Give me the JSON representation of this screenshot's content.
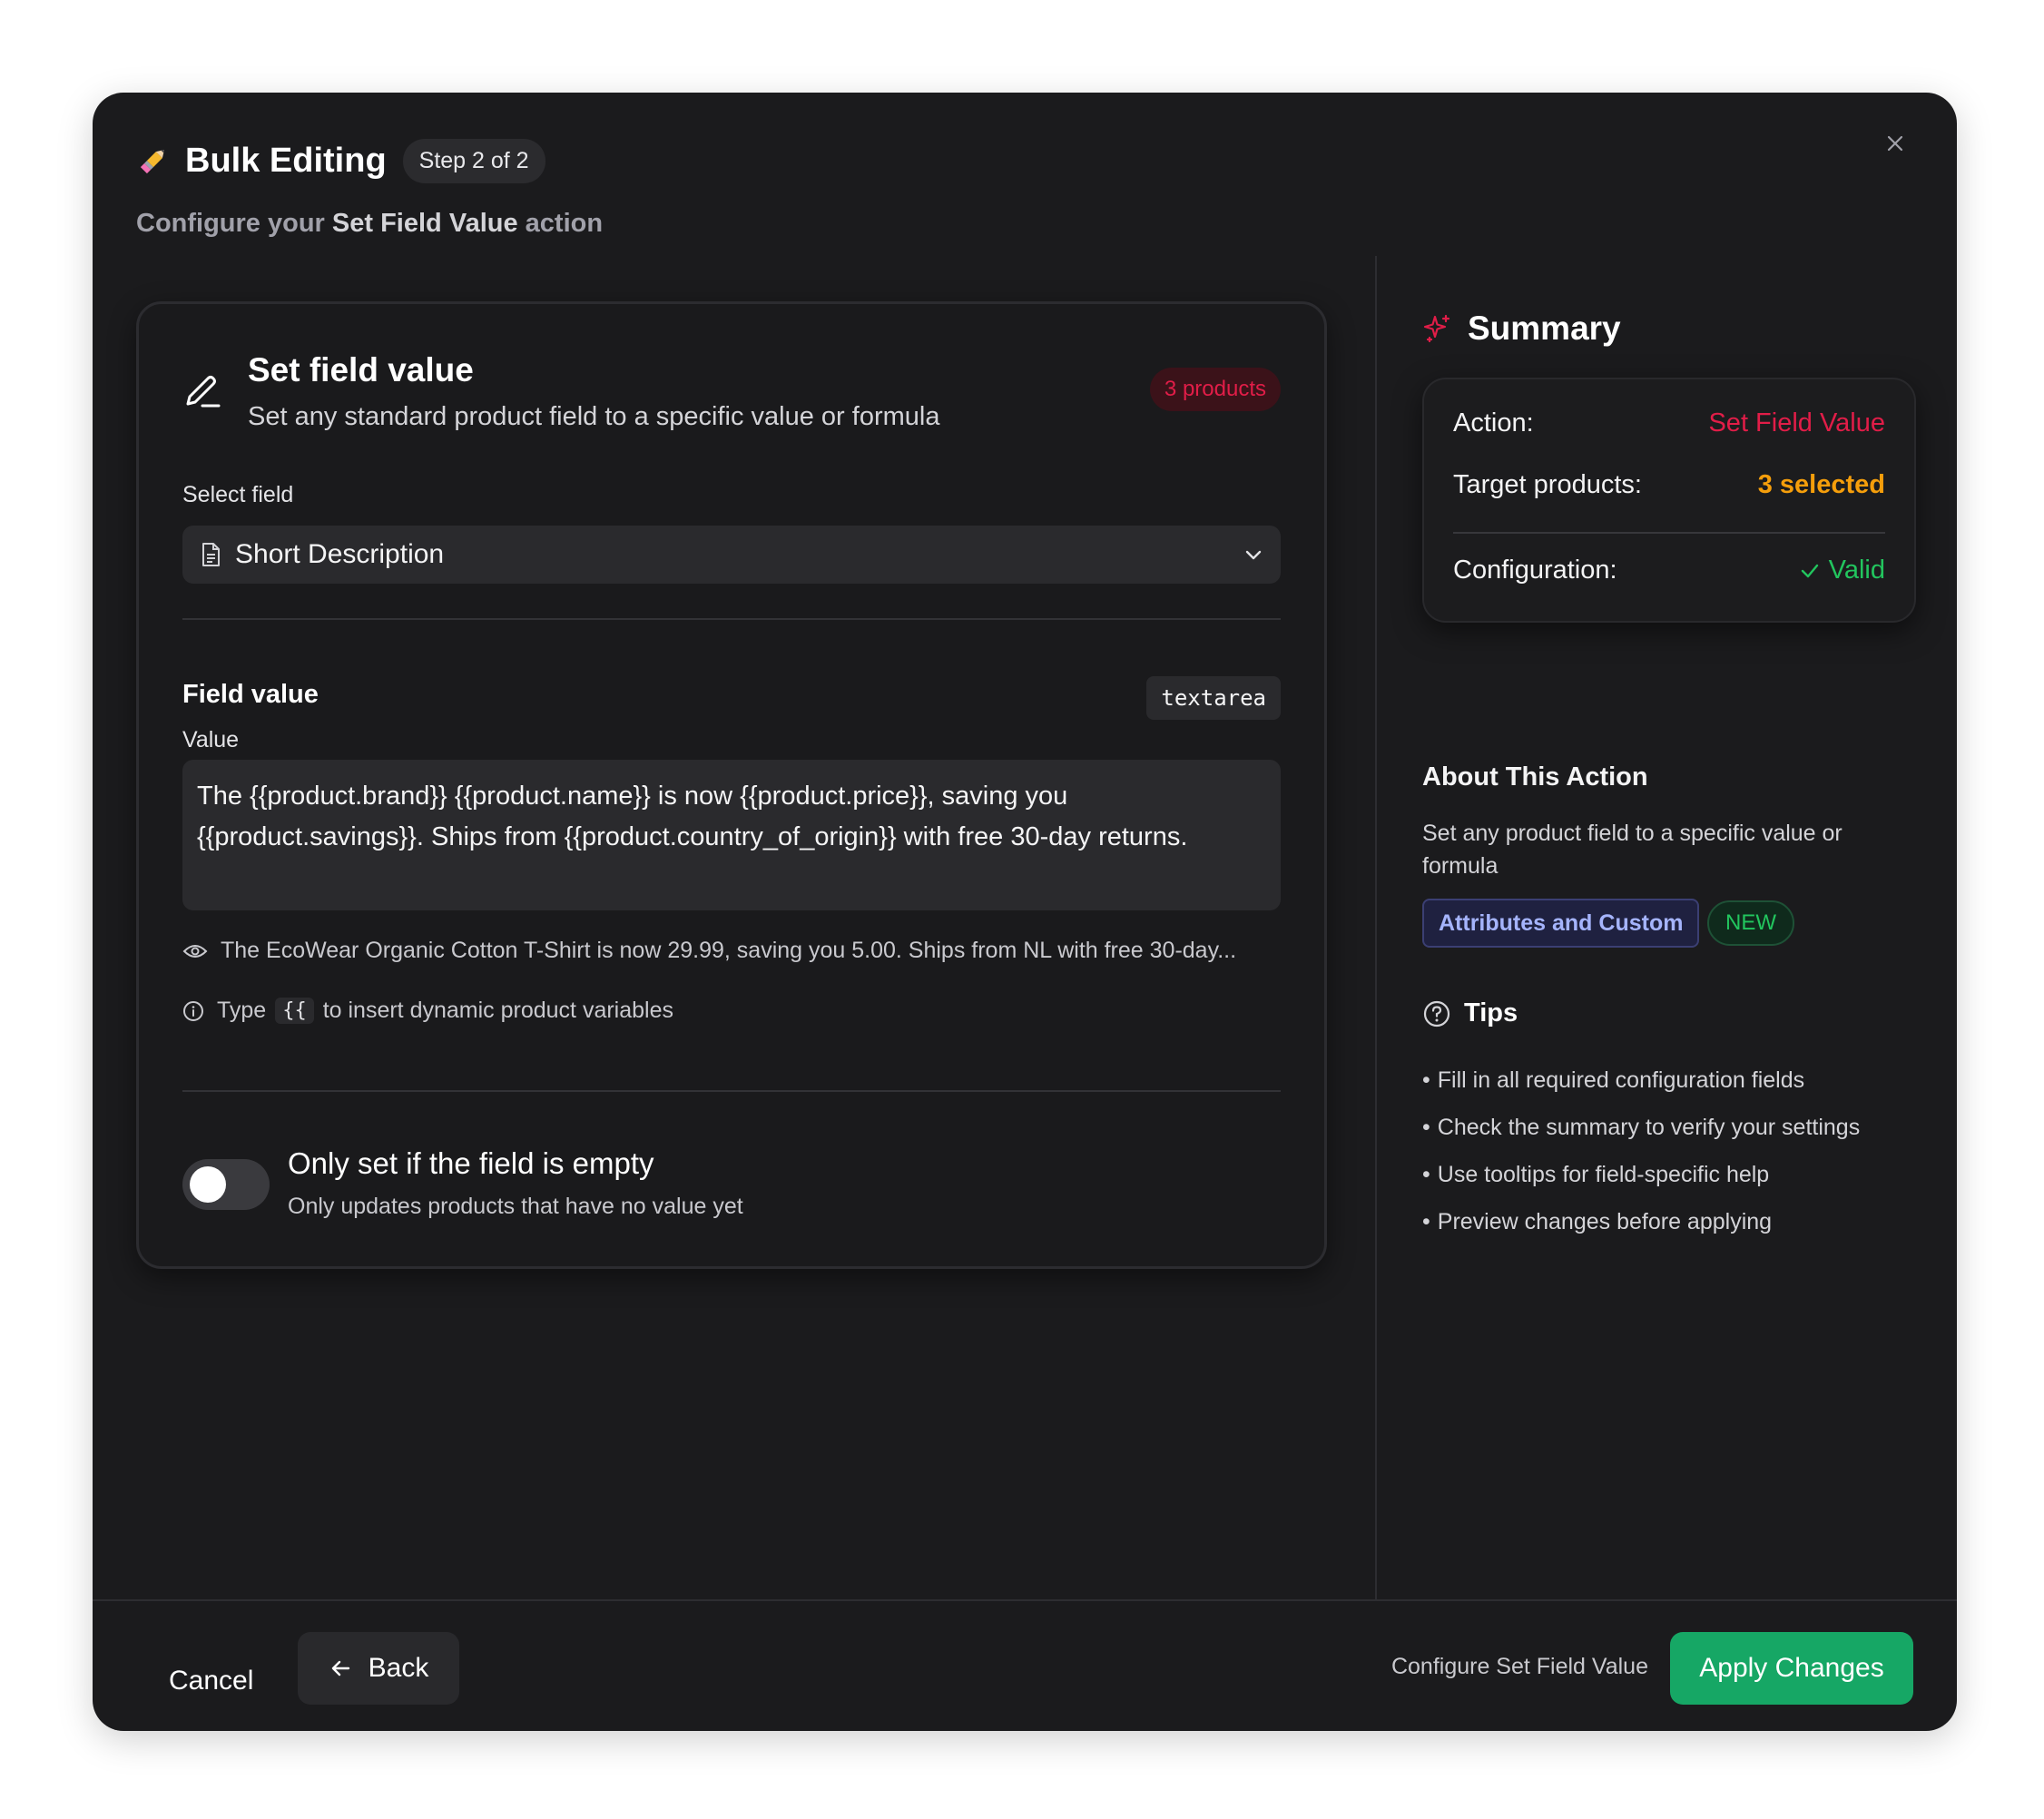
{
  "header": {
    "title": "Bulk Editing",
    "step": "Step 2 of 2",
    "subtitle_prefix": "Configure your",
    "subtitle_action": "Set Field Value",
    "subtitle_suffix": "action"
  },
  "card": {
    "title": "Set field value",
    "description": "Set any standard product field to a specific value or formula",
    "products_badge": "3 products",
    "select_label": "Select field",
    "selected_field": "Short Description",
    "field_value_title": "Field value",
    "field_type": "textarea",
    "value_label": "Value",
    "value": "The {{product.brand}} {{product.name}} is now {{product.price}}, saving you {{product.savings}}. Ships from {{product.country_of_origin}} with free 30-day returns.",
    "preview": "The EcoWear Organic Cotton T-Shirt is now 29.99, saving you 5.00. Ships from NL with free 30-day...",
    "hint_prefix": "Type",
    "hint_key": "{{",
    "hint_suffix": "to insert dynamic product variables",
    "toggle_title": "Only set if the field is empty",
    "toggle_desc": "Only updates products that have no value yet",
    "toggle_on": false
  },
  "summary": {
    "title": "Summary",
    "action_label": "Action:",
    "action_value": "Set Field Value",
    "target_label": "Target products:",
    "target_value": "3 selected",
    "config_label": "Configuration:",
    "config_value": "Valid"
  },
  "about": {
    "title": "About This Action",
    "description": "Set any product field to a specific value or formula",
    "category_badge": "Attributes and Custom",
    "new_badge": "NEW"
  },
  "tips": {
    "title": "Tips",
    "items": [
      "Fill in all required configuration fields",
      "Check the summary to verify your settings",
      "Use tooltips for field-specific help",
      "Preview changes before applying"
    ]
  },
  "footer": {
    "cancel": "Cancel",
    "back": "Back",
    "note": "Configure Set Field Value",
    "apply": "Apply Changes"
  },
  "colors": {
    "accent_red": "#e11d48",
    "accent_orange": "#f59e0b",
    "accent_green": "#22c55e",
    "apply_button": "#16a765",
    "background": "#1b1b1d"
  },
  "icons": [
    "pencil-emoji",
    "close-icon",
    "pencil-icon",
    "document-icon",
    "chevron-down-icon",
    "eye-icon",
    "info-icon",
    "sparkles-icon",
    "check-icon",
    "help-circle-icon",
    "arrow-left-icon"
  ]
}
